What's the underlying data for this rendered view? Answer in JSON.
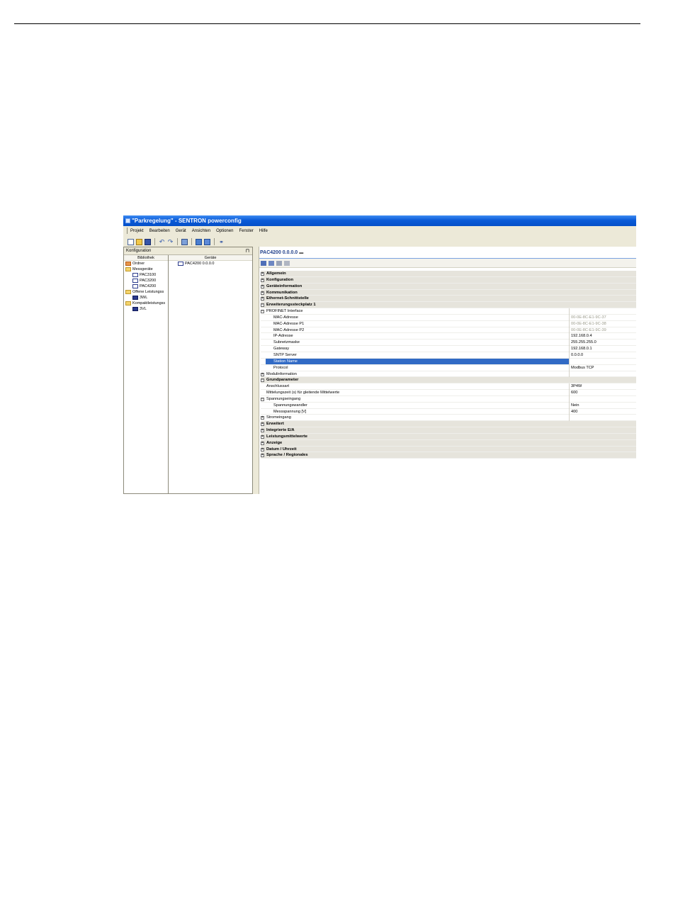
{
  "window": {
    "title": "\"Parkregelung\" - SENTRON powerconfig"
  },
  "menu": [
    "Projekt",
    "Bearbeiten",
    "Gerät",
    "Ansichten",
    "Optionen",
    "Fenster",
    "Hilfe"
  ],
  "toolbar_icons": [
    "new-icon",
    "open-icon",
    "save-icon",
    "undo-icon",
    "redo-icon",
    "device-icon",
    "upload-icon",
    "download-icon",
    "link-icon"
  ],
  "left_panel": {
    "title": "Konfiguration",
    "pin": " ❙",
    "col_library": "Bibliothek",
    "col_devices": "Geräte",
    "library": [
      {
        "label": "Ordner",
        "indent": 0,
        "icon": "folder-red"
      },
      {
        "label": "Messgeräte",
        "indent": 0,
        "icon": "folder"
      },
      {
        "label": "PAC3100",
        "indent": 1,
        "icon": "device"
      },
      {
        "label": "PAC3200",
        "indent": 1,
        "icon": "device"
      },
      {
        "label": "PAC4200",
        "indent": 1,
        "icon": "device"
      },
      {
        "label": "Offene Leistungss",
        "indent": 0,
        "icon": "folder"
      },
      {
        "label": "3WL",
        "indent": 1,
        "icon": "device-dark"
      },
      {
        "label": "Kompaktleistungss",
        "indent": 0,
        "icon": "folder"
      },
      {
        "label": "3VL",
        "indent": 1,
        "icon": "device-dark"
      }
    ],
    "devices": [
      {
        "label": "PAC4200 0.0.0.0"
      }
    ]
  },
  "main": {
    "title": "PAC4200 0.0.0.0",
    "close": "▬",
    "rows": [
      {
        "type": "cat",
        "exp": "+",
        "label": "Allgemein",
        "indent": 0
      },
      {
        "type": "cat",
        "exp": "+",
        "label": "Konfiguration",
        "indent": 0
      },
      {
        "type": "cat",
        "exp": "+",
        "label": "Geräteinformation",
        "indent": 0
      },
      {
        "type": "cat",
        "exp": "+",
        "label": "Kommunikation",
        "indent": 0
      },
      {
        "type": "cat",
        "exp": "+",
        "label": "Ethernet-Schnittstelle",
        "indent": 0
      },
      {
        "type": "cat",
        "exp": "−",
        "label": "Erweiterungssteckplatz 1",
        "indent": 0
      },
      {
        "type": "sub",
        "exp": "−",
        "label": "PROFINET Interface",
        "indent": 0,
        "value": ""
      },
      {
        "type": "sub",
        "label": "MAC-Adresse",
        "indent": 2,
        "value": "00-0E-8C-E1-9C-37",
        "gray": true
      },
      {
        "type": "sub",
        "label": "MAC-Adresse P1",
        "indent": 2,
        "value": "00-0E-8C-E1-9C-38",
        "gray": true
      },
      {
        "type": "sub",
        "label": "MAC-Adresse P2",
        "indent": 2,
        "value": "00-0E-8C-E1-9C-39",
        "gray": true
      },
      {
        "type": "sub",
        "label": "IP-Adresse",
        "indent": 2,
        "value": "192.168.0.4"
      },
      {
        "type": "sub",
        "label": "Subnetzmaske",
        "indent": 2,
        "value": "255.255.255.0"
      },
      {
        "type": "sub",
        "label": "Gateway",
        "indent": 2,
        "value": "192.168.0.1"
      },
      {
        "type": "sub",
        "label": "SNTP Server",
        "indent": 2,
        "value": "0.0.0.0"
      },
      {
        "type": "sub",
        "label": "Station Name",
        "indent": 2,
        "value": "",
        "selected": true
      },
      {
        "type": "sub",
        "label": "Protocol",
        "indent": 2,
        "value": "Modbus TCP"
      },
      {
        "type": "sub",
        "exp": "+",
        "label": "Modulinformation",
        "indent": 0,
        "value": ""
      },
      {
        "type": "cat",
        "exp": "−",
        "label": "Grundparameter",
        "indent": 0
      },
      {
        "type": "sub",
        "label": "Anschlussart",
        "indent": 1,
        "value": "3P4W"
      },
      {
        "type": "sub",
        "label": "Mittelungszeit (s) für gleitende Mittelwerte",
        "indent": 1,
        "value": "600"
      },
      {
        "type": "sub",
        "exp": "−",
        "label": "Spannungseingang",
        "indent": 0,
        "value": ""
      },
      {
        "type": "sub",
        "label": "Spannungswandler",
        "indent": 2,
        "value": "Nein"
      },
      {
        "type": "sub",
        "label": "Messspannung [V]",
        "indent": 2,
        "value": "400"
      },
      {
        "type": "sub",
        "exp": "+",
        "label": "Stromeingang",
        "indent": 0,
        "value": ""
      },
      {
        "type": "cat",
        "exp": "+",
        "label": "Erweitert",
        "indent": 0
      },
      {
        "type": "cat",
        "exp": "+",
        "label": "Integrierte E/A",
        "indent": 0
      },
      {
        "type": "cat",
        "exp": "+",
        "label": "Leistungsmittelwerte",
        "indent": 0
      },
      {
        "type": "cat",
        "exp": "+",
        "label": "Anzeige",
        "indent": 0
      },
      {
        "type": "cat",
        "exp": "+",
        "label": "Datum / Uhrzeit",
        "indent": 0
      },
      {
        "type": "cat",
        "exp": "+",
        "label": "Sprache / Regionales",
        "indent": 0
      }
    ]
  }
}
